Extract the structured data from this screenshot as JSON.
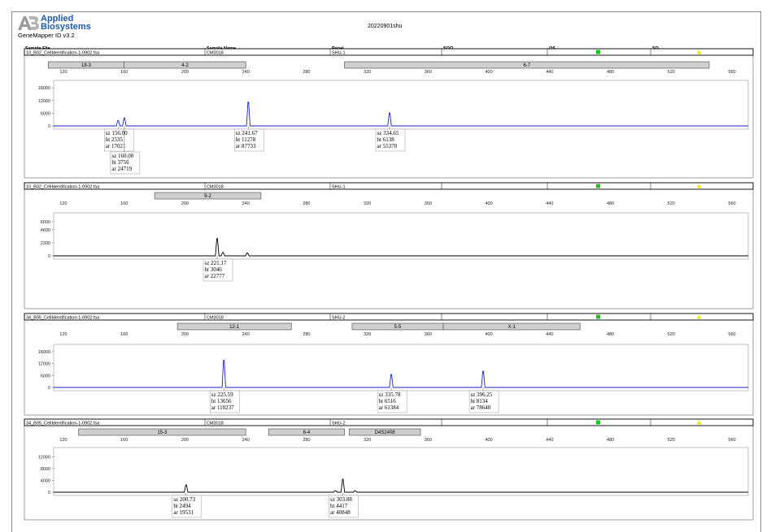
{
  "header": {
    "brand_line1": "Applied",
    "brand_line2": "Biosystems",
    "version": "GeneMapper ID v3.2",
    "title": "20220901shu"
  },
  "columns": {
    "sample_file": "Sample File",
    "sample_name": "Sample Name",
    "panel": "Panel",
    "sqo": "SQO",
    "os": "OS",
    "sq": "SQ"
  },
  "colors": {
    "blue": "#1a22c8",
    "black": "#000000",
    "flag_green": "#11cc11",
    "flag_yellow": "#f2e600",
    "bin_fill": "#cfcfcf"
  },
  "chart_data": [
    {
      "type": "line",
      "sample_file": "10_B02_CellIdentification-1-0902.fsa",
      "sample_name": "CM3018",
      "panel_name": "SHU-1",
      "color": "blue",
      "xlim": [
        100,
        575
      ],
      "xticks": [
        120,
        160,
        200,
        240,
        280,
        320,
        360,
        400,
        440,
        480,
        520,
        560
      ],
      "ylim": [
        0,
        20000
      ],
      "yticks": [
        18000,
        12000,
        6000,
        0
      ],
      "bins": [
        {
          "label": "18-3",
          "from": 110,
          "to": 160
        },
        {
          "label": "4-2",
          "from": 160,
          "to": 240
        },
        {
          "label": "6-7",
          "from": 305,
          "to": 545
        }
      ],
      "peaks": [
        {
          "x": 156.0,
          "y": 2535
        },
        {
          "x": 160.08,
          "y": 3756
        },
        {
          "x": 241.67,
          "y": 11278
        },
        {
          "x": 334.65,
          "y": 6138
        }
      ],
      "labels": [
        {
          "at": 156.0,
          "row": 0,
          "sz": "sz 156.00",
          "ht": "ht 2535",
          "ar": "ar 17021"
        },
        {
          "at": 160.08,
          "row": 1,
          "sz": "sz 160.08",
          "ht": "ht 3756",
          "ar": "ar 24719"
        },
        {
          "at": 241.67,
          "row": 0,
          "sz": "sz 241.67",
          "ht": "ht 11278",
          "ar": "ar 87733"
        },
        {
          "at": 334.65,
          "row": 0,
          "sz": "sz 334.65",
          "ht": "ht 6138",
          "ar": "ar 55370"
        }
      ]
    },
    {
      "type": "line",
      "sample_file": "10_B02_CellIdentification-1-0902.fsa",
      "sample_name": "CM3018",
      "panel_name": "SHU-1",
      "color": "black",
      "xlim": [
        100,
        575
      ],
      "xticks": [
        120,
        160,
        200,
        240,
        280,
        320,
        360,
        400,
        440,
        480,
        520,
        560
      ],
      "ylim": [
        0,
        7000
      ],
      "yticks": [
        6000,
        4600,
        2300,
        0
      ],
      "bins": [
        {
          "label": "9-2",
          "from": 180,
          "to": 250
        }
      ],
      "peaks": [
        {
          "x": 221.17,
          "y": 3046
        },
        {
          "x": 225.0,
          "y": 600
        },
        {
          "x": 241.0,
          "y": 500
        }
      ],
      "labels": [
        {
          "at": 221.17,
          "row": 0,
          "sz": "sz 221.17",
          "ht": "ht 3046",
          "ar": "ar 22777"
        }
      ]
    },
    {
      "type": "line",
      "sample_file": "34_B05_CellIdentification-1-0902.fsa",
      "sample_name": "CM3018",
      "panel_name": "SHU-2",
      "color": "blue",
      "xlim": [
        100,
        575
      ],
      "xticks": [
        120,
        160,
        200,
        240,
        280,
        320,
        360,
        400,
        440,
        480,
        520,
        560
      ],
      "ylim": [
        0,
        20000
      ],
      "yticks": [
        18000,
        12000,
        6000,
        0
      ],
      "bins": [
        {
          "label": "12-1",
          "from": 195,
          "to": 270
        },
        {
          "label": "5-5",
          "from": 310,
          "to": 370
        },
        {
          "label": "X-1",
          "from": 370,
          "to": 460
        }
      ],
      "peaks": [
        {
          "x": 225.59,
          "y": 13656
        },
        {
          "x": 335.78,
          "y": 6516
        },
        {
          "x": 396.25,
          "y": 8134
        }
      ],
      "labels": [
        {
          "at": 225.59,
          "row": 0,
          "sz": "sz 225.59",
          "ht": "ht 13656",
          "ar": "ar 110237"
        },
        {
          "at": 335.78,
          "row": 0,
          "sz": "sz 335.78",
          "ht": "ht 6516",
          "ar": "ar 61384"
        },
        {
          "at": 396.25,
          "row": 0,
          "sz": "sz 396.25",
          "ht": "ht 8134",
          "ar": "ar 78640"
        }
      ]
    },
    {
      "type": "line",
      "sample_file": "34_B05_CellIdentification-1-0902.fsa",
      "sample_name": "CM3018",
      "panel_name": "SHU-2",
      "color": "black",
      "xlim": [
        100,
        575
      ],
      "xticks": [
        120,
        160,
        200,
        240,
        280,
        320,
        360,
        400,
        440,
        480,
        520,
        560
      ],
      "ylim": [
        0,
        14000
      ],
      "yticks": [
        12000,
        8000,
        4000,
        0
      ],
      "bins": [
        {
          "label": "15-3",
          "from": 130,
          "to": 240
        },
        {
          "label": "6-4",
          "from": 255,
          "to": 305
        },
        {
          "label": "D4S2408",
          "from": 308,
          "to": 355
        }
      ],
      "peaks": [
        {
          "x": 200.73,
          "y": 2494
        },
        {
          "x": 303.88,
          "y": 4417
        },
        {
          "x": 299.0,
          "y": 500
        },
        {
          "x": 312.0,
          "y": 500
        }
      ],
      "labels": [
        {
          "at": 200.73,
          "row": 0,
          "sz": "sz 200.73",
          "ht": "ht 2494",
          "ar": "ar 19531"
        },
        {
          "at": 303.88,
          "row": 0,
          "sz": "sz 303.88",
          "ht": "ht 4417",
          "ar": "ar 40848"
        }
      ]
    }
  ]
}
